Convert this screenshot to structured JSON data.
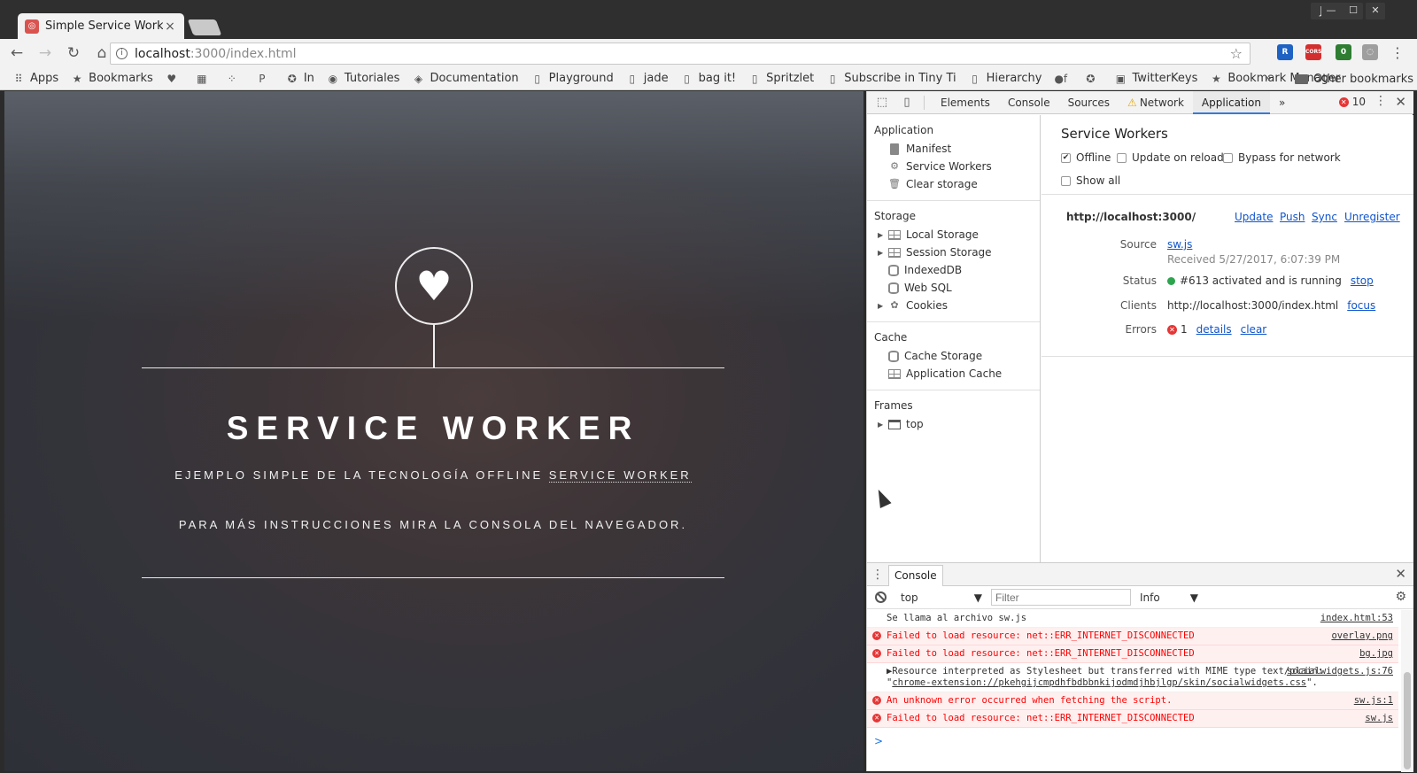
{
  "browser": {
    "tab_title": "Simple Service Worker",
    "tab_close": "×",
    "window_user": "Jess",
    "window_buttons": [
      "—",
      "☐",
      "✕"
    ],
    "url_host": "localhost",
    "url_path": ":3000/index.html",
    "nav": {
      "back": "←",
      "forward": "→",
      "reload": "↻",
      "home": "⌂"
    },
    "star": "☆",
    "extensions": [
      {
        "label": "R",
        "color": "#1e63c3"
      },
      {
        "label": "CORS",
        "color": "#d32f2f"
      },
      {
        "label": "0",
        "color": "#2e7d32"
      },
      {
        "label": "◌",
        "color": "#9e9e9e"
      }
    ],
    "menu": "⋮"
  },
  "bookmarks": {
    "items": [
      {
        "label": "Apps",
        "icon": "apps-grid-icon",
        "glyph": "⠿"
      },
      {
        "label": "Bookmarks",
        "icon": "star-icon",
        "glyph": "★"
      },
      {
        "label": "",
        "icon": "heart-icon",
        "glyph": "♥"
      },
      {
        "label": "",
        "icon": "chart-icon",
        "glyph": "▦"
      },
      {
        "label": "",
        "icon": "dots-icon",
        "glyph": "⁘"
      },
      {
        "label": "",
        "icon": "p-icon",
        "glyph": "P"
      },
      {
        "label": "In",
        "icon": "circle-star-icon",
        "glyph": "✪"
      },
      {
        "label": "Tutoriales",
        "icon": "globe-icon",
        "glyph": "◉"
      },
      {
        "label": "Documentation",
        "icon": "drive-icon",
        "glyph": "◈"
      },
      {
        "label": "Playground",
        "icon": "page-icon",
        "glyph": "▯"
      },
      {
        "label": "jade",
        "icon": "page-icon",
        "glyph": "▯"
      },
      {
        "label": "bag it!",
        "icon": "page-icon",
        "glyph": "▯"
      },
      {
        "label": "Spritzlet",
        "icon": "page-icon",
        "glyph": "▯"
      },
      {
        "label": "Subscribe in Tiny Ti",
        "icon": "page-icon",
        "glyph": "▯"
      },
      {
        "label": "Hierarchy",
        "icon": "page-icon",
        "glyph": "▯"
      },
      {
        "label": "",
        "icon": "of-icon",
        "glyph": "●f"
      },
      {
        "label": "",
        "icon": "circle-star-icon",
        "glyph": "✪"
      },
      {
        "label": "TwitterKeys",
        "icon": "keys-icon",
        "glyph": "▣"
      },
      {
        "label": "Bookmark Manager",
        "icon": "star-icon",
        "glyph": "★"
      }
    ],
    "more": "»",
    "other": "Other bookmarks"
  },
  "hero": {
    "heart": "♥",
    "title": "SERVICE WORKER",
    "subtitle_prefix": "EJEMPLO SIMPLE DE LA TECNOLOGÍA OFFLINE ",
    "subtitle_link": "SERVICE WORKER",
    "instructions": "PARA MÁS INSTRUCCIONES MIRA LA CONSOLA DEL NAVEGADOR."
  },
  "devtools": {
    "tabs": [
      "Elements",
      "Console",
      "Sources",
      "Network",
      "Application"
    ],
    "active_tab": "Application",
    "more_tabs": "»",
    "error_count": "10",
    "sidebar": {
      "application": {
        "heading": "Application",
        "items": [
          "Manifest",
          "Service Workers",
          "Clear storage"
        ]
      },
      "storage": {
        "heading": "Storage",
        "items": [
          "Local Storage",
          "Session Storage",
          "IndexedDB",
          "Web SQL",
          "Cookies"
        ]
      },
      "cache": {
        "heading": "Cache",
        "items": [
          "Cache Storage",
          "Application Cache"
        ]
      },
      "frames": {
        "heading": "Frames",
        "items": [
          "top"
        ]
      }
    },
    "service_workers": {
      "title": "Service Workers",
      "offline": "Offline",
      "update_on_reload": "Update on reload",
      "bypass": "Bypass for network",
      "show_all": "Show all",
      "origin": "http://localhost:3000/",
      "actions": [
        "Update",
        "Push",
        "Sync",
        "Unregister"
      ],
      "source_label": "Source",
      "source_file": "sw.js",
      "received": "Received 5/27/2017, 6:07:39 PM",
      "status_label": "Status",
      "status_text": "#613 activated and is running",
      "status_action": "stop",
      "clients_label": "Clients",
      "clients_url": "http://localhost:3000/index.html",
      "clients_action": "focus",
      "errors_label": "Errors",
      "errors_count": "1",
      "errors_details": "details",
      "errors_clear": "clear"
    },
    "console": {
      "tab": "Console",
      "context": "top",
      "filter_placeholder": "Filter",
      "level": "Info",
      "messages": [
        {
          "type": "log",
          "text": "Se llama al archivo sw.js",
          "source": "index.html:53"
        },
        {
          "type": "error",
          "text": "Failed to load resource: net::ERR_INTERNET_DISCONNECTED",
          "source": "overlay.png"
        },
        {
          "type": "error",
          "text": "Failed to load resource: net::ERR_INTERNET_DISCONNECTED",
          "source": "bg.jpg"
        },
        {
          "type": "log",
          "text_1": "▶Resource interpreted as Stylesheet but transferred with MIME type text/plain: \"",
          "link": "chrome-extension://pkehgijcmpdhfbdbbnkijodmdjhbjlgp/skin/socialwidgets.css",
          "text_2": "\".",
          "source": "socialwidgets.js:76"
        },
        {
          "type": "error",
          "text": "An unknown error occurred when fetching the script.",
          "source": "sw.js:1"
        },
        {
          "type": "error",
          "text": "Failed to load resource: net::ERR_INTERNET_DISCONNECTED",
          "source": "sw.js"
        }
      ],
      "prompt": ">"
    }
  }
}
